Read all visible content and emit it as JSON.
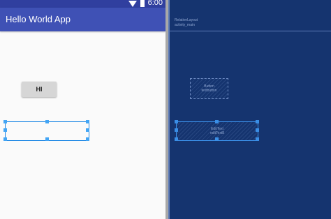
{
  "status_bar": {
    "time": "6:00",
    "wifi_icon": "wifi-icon",
    "battery_icon": "battery-icon"
  },
  "app_bar": {
    "title": "Hello World App"
  },
  "design": {
    "button_label": "HI"
  },
  "blueprint": {
    "layout_type": "RelativeLayout",
    "layout_id": "activity_main",
    "button_type": "Button",
    "button_id": "textbutton",
    "edittext_type": "EditText",
    "edittext_id": "editText8"
  },
  "colors": {
    "primary": "#3f51b5",
    "primary_dark": "#303f9f",
    "blueprint_bg": "#15346f",
    "selection": "#42a5f5"
  }
}
